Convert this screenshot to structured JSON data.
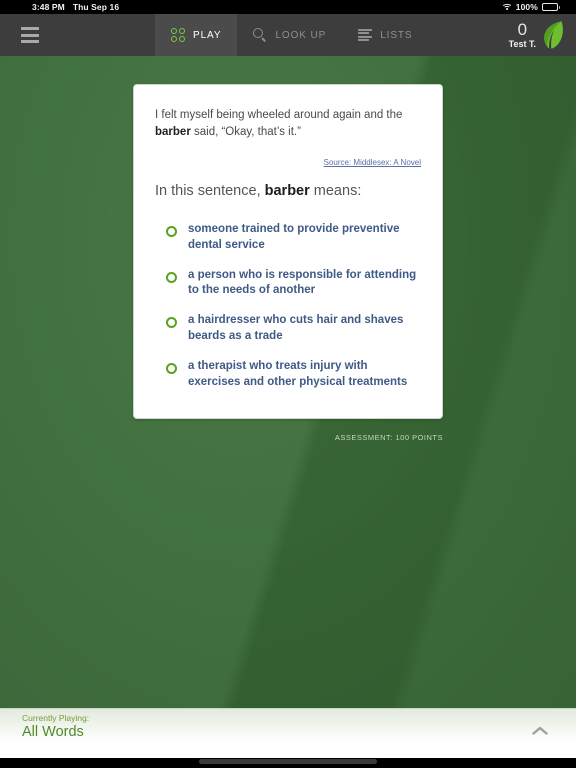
{
  "status_bar": {
    "time": "3:48 PM",
    "date": "Thu Sep 16",
    "battery_percent": "100%",
    "wifi_icon": "wifi-icon",
    "battery_icon": "battery-icon"
  },
  "navbar": {
    "menu_icon": "hamburger-menu-icon",
    "tabs": [
      {
        "label": "PLAY",
        "icon": "four-dots-icon",
        "active": true
      },
      {
        "label": "LOOK UP",
        "icon": "search-icon",
        "active": false
      },
      {
        "label": "LISTS",
        "icon": "list-icon",
        "active": false
      }
    ],
    "score": "0",
    "user_name": "Test T.",
    "logo_icon": "leaf-logo-icon"
  },
  "card": {
    "passage_before": "I felt myself being wheeled around again and the ",
    "passage_bold": "barber",
    "passage_after": " said, “Okay, that’s it.”",
    "source_link": "Source: Middlesex: A Novel",
    "prompt_before": "In this sentence, ",
    "prompt_bold": "barber",
    "prompt_after": " means:",
    "options": [
      {
        "text": "someone trained to provide preventive dental service",
        "selected": false
      },
      {
        "text": "a person who is responsible for attending to the needs of another",
        "selected": false
      },
      {
        "text": "a hairdresser who cuts hair and shaves beards as a trade",
        "selected": false
      },
      {
        "text": "a therapist who treats injury with exercises and other physical treatments",
        "selected": false
      }
    ]
  },
  "assessment_note": "ASSESSMENT: 100 POINTS",
  "play_bar": {
    "label": "Currently Playing:",
    "value": "All Words",
    "expand_icon": "chevron-up-icon"
  },
  "colors": {
    "stage_green": "#3a6b37",
    "accent_green": "#5aa21d",
    "option_blue": "#3f5a86",
    "link_blue": "#5a6fa8",
    "navbar_dark": "#3d3d3d",
    "navtab_active": "#4b4b4b"
  }
}
